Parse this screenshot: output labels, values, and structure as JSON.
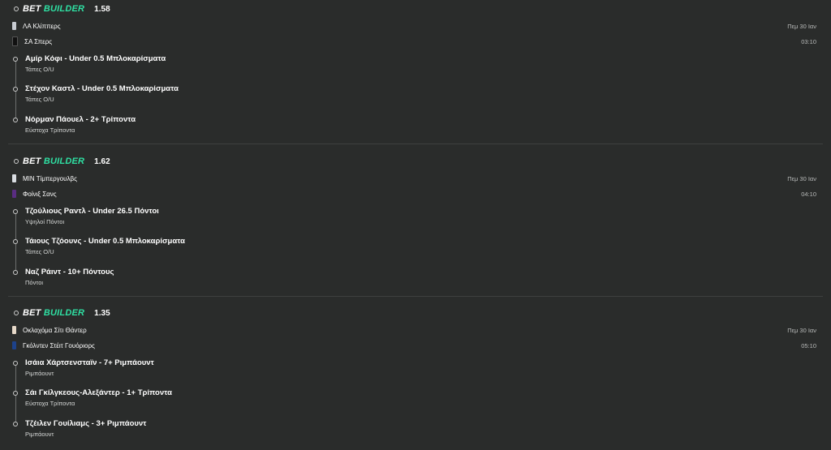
{
  "builders": [
    {
      "brand_1": "BET",
      "brand_2": "BUILDER",
      "odds": "1.58",
      "home": {
        "name": "ΛΑ Κλίππερς",
        "jersey_color": "#c8ccd2"
      },
      "away": {
        "name": "ΣΑ Σπερς",
        "jersey_color": "#111111"
      },
      "date": "Πεμ 30 Ιαν",
      "time": "03:10",
      "selections": [
        {
          "title": "Αμίρ Κόφι - Under 0.5 Μπλοκαρίσματα",
          "market": "Τάπες Ο/U"
        },
        {
          "title": "Στέχον Καστλ - Under 0.5 Μπλοκαρίσματα",
          "market": "Τάπες Ο/U"
        },
        {
          "title": "Νόρμαν Πάουελ - 2+ Τρίποντα",
          "market": "Εύστοχα Τρίποντα"
        }
      ]
    },
    {
      "brand_1": "BET",
      "brand_2": "BUILDER",
      "odds": "1.62",
      "home": {
        "name": "ΜΙΝ Τίμπεργουλβς",
        "jersey_color": "#d9dde2"
      },
      "away": {
        "name": "Φοίνιξ Σανς",
        "jersey_color": "#5a2d82"
      },
      "date": "Πεμ 30 Ιαν",
      "time": "04:10",
      "selections": [
        {
          "title": "Τζούλιους Ραντλ - Under 26.5 Πόντοι",
          "market": "Υψηλοί Πόντοι"
        },
        {
          "title": "Τάιους Τζόουνς - Under 0.5 Μπλοκαρίσματα",
          "market": "Τάπες Ο/U"
        },
        {
          "title": "Ναζ Ράιντ - 10+ Πόντους",
          "market": "Πόντοι"
        }
      ]
    },
    {
      "brand_1": "BET",
      "brand_2": "BUILDER",
      "odds": "1.35",
      "home": {
        "name": "Οκλαχόμα Σίτι Θάντερ",
        "jersey_color": "#e6d8c8"
      },
      "away": {
        "name": "Γκόλντεν Στέιτ Γουόριορς",
        "jersey_color": "#1d428a"
      },
      "date": "Πεμ 30 Ιαν",
      "time": "05:10",
      "selections": [
        {
          "title": "Ισάια Χάρτσενσταϊν - 7+ Ριμπάουντ",
          "market": "Ριμπάουντ"
        },
        {
          "title": "Σάι Γκίλγκεους-Αλεξάντερ - 1+ Τρίποντα",
          "market": "Εύστοχα Τρίποντα"
        },
        {
          "title": "Τζέιλεν Γουίλιαμς - 3+ Ριμπάουντ",
          "market": "Ριμπάουντ"
        }
      ]
    }
  ]
}
